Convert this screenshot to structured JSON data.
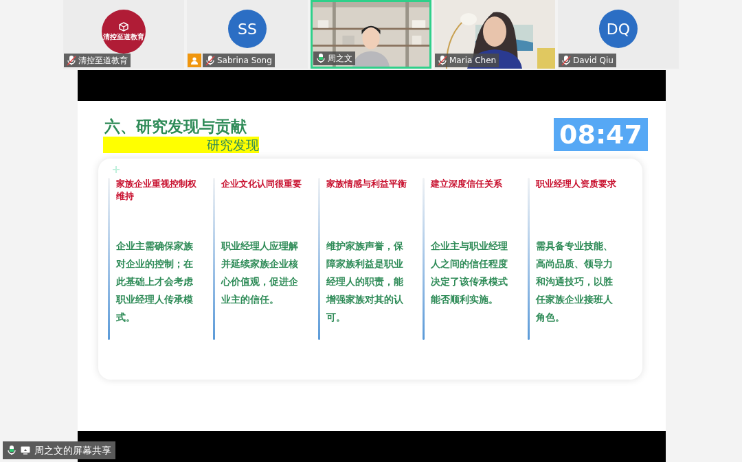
{
  "participants": [
    {
      "name": "清控至道教育",
      "kind": "logo",
      "logo_text": "清控至道教育",
      "muted": true,
      "selected": false,
      "host_badge": false
    },
    {
      "name": "Sabrina Song",
      "kind": "initials",
      "initials": "SS",
      "muted": true,
      "selected": false,
      "host_badge": true
    },
    {
      "name": "周之文",
      "kind": "video",
      "muted": false,
      "selected": true,
      "host_badge": false
    },
    {
      "name": "Maria Chen",
      "kind": "video",
      "muted": true,
      "selected": false,
      "host_badge": false
    },
    {
      "name": "David Qiu",
      "kind": "initials",
      "initials": "DQ",
      "muted": true,
      "selected": false,
      "host_badge": false
    }
  ],
  "slide": {
    "title": "六、研究发现与贡献",
    "subtitle": "研究发现",
    "timer": "08:47",
    "columns": [
      {
        "heading": "家族企业重视控制权维持",
        "body": "企业主需确保家族对企业的控制；在此基础上才会考虑职业经理人传承模式。"
      },
      {
        "heading": "企业文化认同很重要",
        "body": "职业经理人应理解并延续家族企业核心价值观，促进企业主的信任。"
      },
      {
        "heading": "家族情感与利益平衡",
        "body": "维护家族声誉，保障家族利益是职业经理人的职责，能增强家族对其的认可。"
      },
      {
        "heading": "建立深度信任关系",
        "body": "企业主与职业经理人之间的信任程度决定了该传承模式能否顺利实施。"
      },
      {
        "heading": "职业经理人资质要求",
        "body": "需具备专业技能、高尚品质、领导力和沟通技巧，以胜任家族企业接班人角色。"
      }
    ]
  },
  "share_label": {
    "text": "周之文的屏幕共享",
    "muted": false
  }
}
